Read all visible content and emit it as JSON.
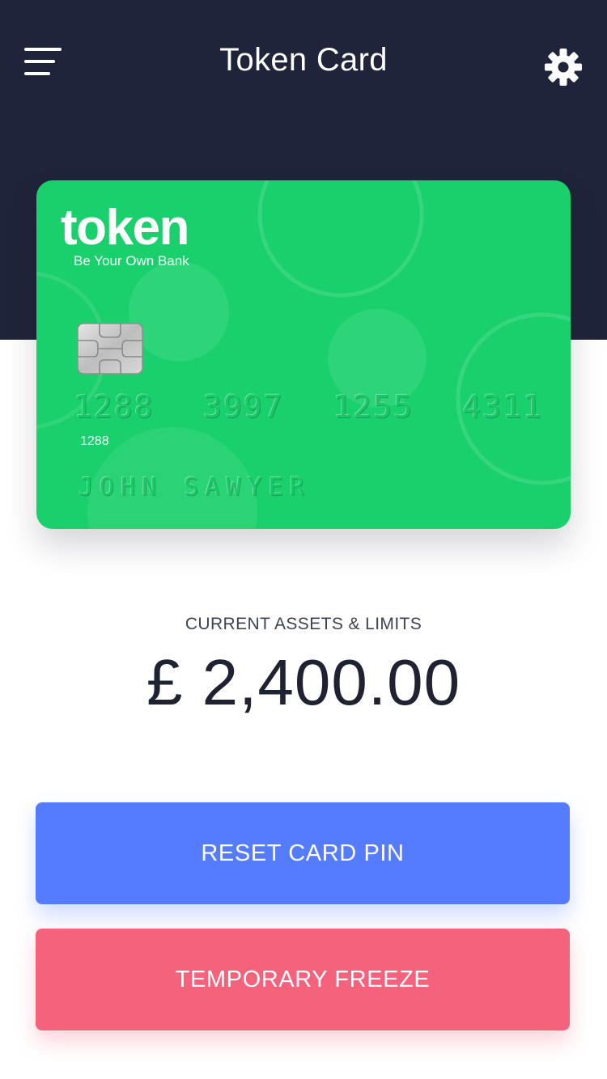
{
  "header": {
    "title": "Token Card",
    "menu_icon": "hamburger-menu-icon",
    "settings_icon": "gear-icon"
  },
  "card": {
    "brand": "token",
    "tagline": "Be Your Own Bank",
    "number_groups": [
      "1288",
      "3997",
      "1255",
      "4311"
    ],
    "number_prefix_small": "1288",
    "holder": "JOHN SAWYER",
    "color": "#19d06c"
  },
  "assets": {
    "label": "CURRENT ASSETS & LIMITS",
    "amount": "£ 2,400.00"
  },
  "actions": {
    "reset_pin": "RESET CARD PIN",
    "freeze": "TEMPORARY FREEZE"
  },
  "colors": {
    "header_bg": "#1f243a",
    "reset_button": "#557cfe",
    "freeze_button": "#f4627c"
  }
}
